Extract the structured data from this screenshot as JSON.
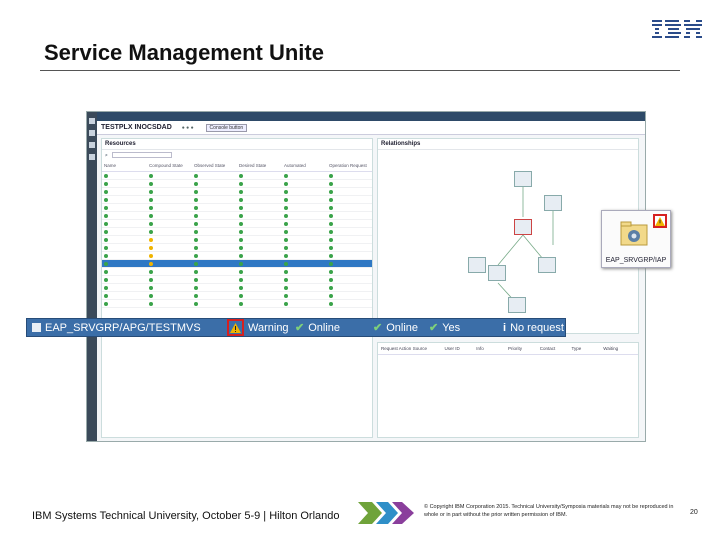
{
  "slide": {
    "title": "Service Management Unite",
    "logo": "IBM",
    "footer": "IBM Systems Technical University, October 5-9 | Hilton Orlando",
    "copyright": "© Copyright IBM Corporation 2015. Technical University/Symposia materials may not be reproduced in whole or in part without the prior written permission of IBM.",
    "page_number": "20"
  },
  "app": {
    "window_title": "TESTPLX INOCSDAD",
    "tab_button": "Console button",
    "resources_title": "Resources",
    "relationships_title": "Relationships",
    "table": {
      "columns": [
        "Name",
        "Compound State",
        "Observed State",
        "Desired State",
        "Automated",
        "Operation Request"
      ],
      "rows": [
        {
          "state": "ok",
          "selected": false
        },
        {
          "state": "ok",
          "selected": false
        },
        {
          "state": "ok",
          "selected": false
        },
        {
          "state": "ok",
          "selected": false
        },
        {
          "state": "ok",
          "selected": false
        },
        {
          "state": "ok",
          "selected": false
        },
        {
          "state": "ok",
          "selected": false
        },
        {
          "state": "ok",
          "selected": false
        },
        {
          "state": "warn",
          "selected": false
        },
        {
          "state": "warn",
          "selected": false
        },
        {
          "state": "warn",
          "selected": false
        },
        {
          "state": "warn",
          "selected": true
        },
        {
          "state": "ok",
          "selected": false
        },
        {
          "state": "ok",
          "selected": false
        },
        {
          "state": "ok",
          "selected": false
        },
        {
          "state": "ok",
          "selected": false
        },
        {
          "state": "ok",
          "selected": false
        }
      ]
    },
    "requests_columns": [
      "Request Action",
      "Source",
      "User ID",
      "Info",
      "Priority",
      "Contact",
      "Type",
      "Waiting"
    ]
  },
  "zoom_row": {
    "name": "EAP_SRVGRP/APG/TESTMVS",
    "compound_state": "Warning",
    "observed_state": "Online",
    "desired_state": "Online",
    "automated": "Yes",
    "operation_request": "No request"
  },
  "callout": {
    "label": "EAP_SRVGRP/IAP"
  },
  "colors": {
    "row_highlight": "#3b6ea8",
    "warning": "#f0b400",
    "warning_outline": "#d62020",
    "ok": "#3aa34a"
  }
}
